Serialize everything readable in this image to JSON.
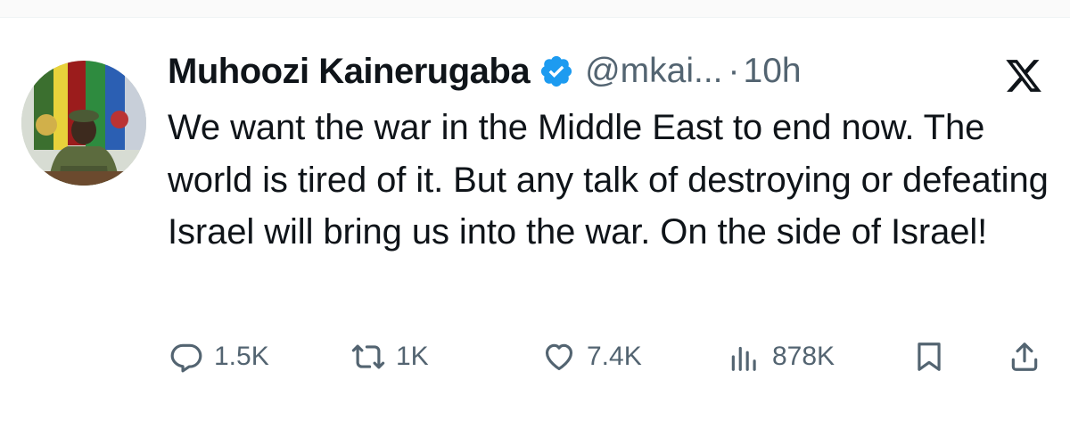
{
  "tweet": {
    "display_name": "Muhoozi Kainerugaba",
    "handle": "@mkai...",
    "separator": "·",
    "time": "10h",
    "text": "We want the war in the Middle East to end now. The world is tired of it. But any talk of destroying or defeating Israel will bring us into the war. On the side of Israel!",
    "verified": true
  },
  "actions": {
    "replies": "1.5K",
    "reposts": "1K",
    "likes": "7.4K",
    "views": "878K"
  },
  "icons": {
    "verified": "verified-badge-icon",
    "brand": "x-logo-icon",
    "reply": "reply-icon",
    "repost": "repost-icon",
    "like": "heart-icon",
    "views": "views-icon",
    "bookmark": "bookmark-icon",
    "share": "share-icon"
  },
  "colors": {
    "text": "#0f1419",
    "secondary": "#536471",
    "verified": "#1d9bf0"
  }
}
